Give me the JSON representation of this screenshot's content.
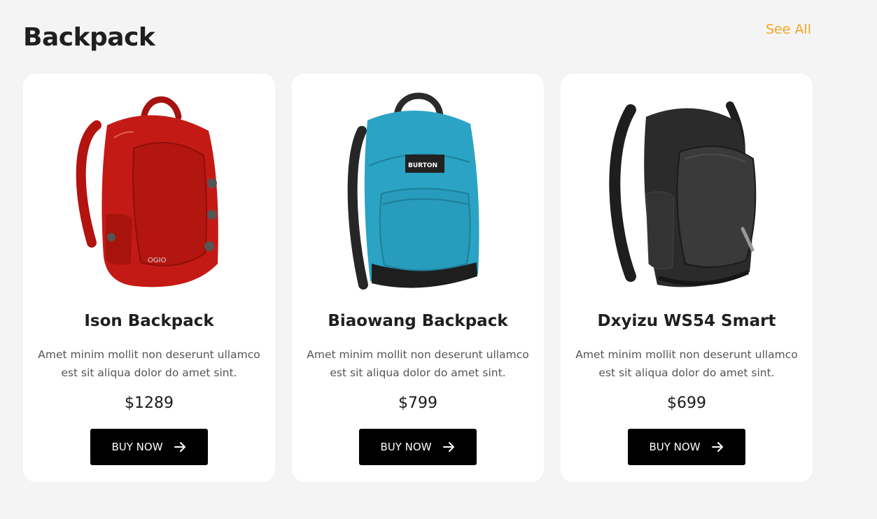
{
  "section": {
    "title": "Backpack",
    "see_all": "See All"
  },
  "products": [
    {
      "name": "Ison Backpack",
      "description": "Amet minim mollit non deserunt ullamco est sit aliqua dolor do amet sint.",
      "price": "$1289",
      "button_label": "BUY NOW",
      "image_icon": "red-backpack-image",
      "brand_mark": "OGIO",
      "color": "#c41a15"
    },
    {
      "name": "Biaowang Backpack",
      "description": "Amet minim mollit non deserunt ullamco est sit aliqua dolor do amet sint.",
      "price": "$799",
      "button_label": "BUY NOW",
      "image_icon": "blue-backpack-image",
      "brand_mark": "BURTON",
      "color": "#2aa3c4"
    },
    {
      "name": "Dxyizu WS54 Smart",
      "description": "Amet minim mollit non deserunt ullamco est sit aliqua dolor do amet sint.",
      "price": "$699",
      "button_label": "BUY NOW",
      "image_icon": "black-backpack-image",
      "color": "#2b2b2b"
    }
  ],
  "colors": {
    "accent": "#f5a623",
    "background": "#f4f4f4",
    "card": "#ffffff",
    "button": "#000000"
  }
}
